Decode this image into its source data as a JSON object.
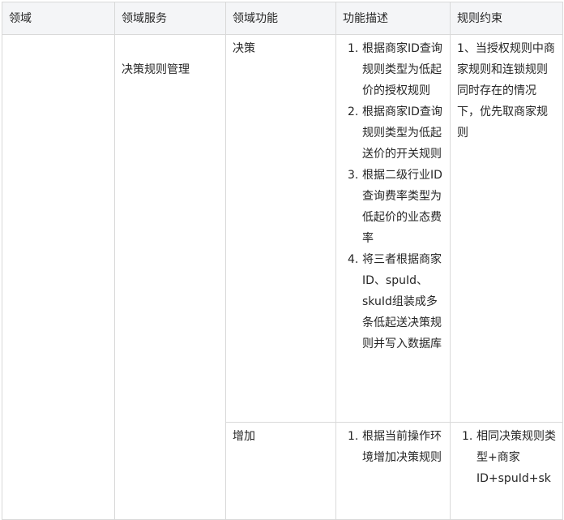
{
  "headers": [
    "领域",
    "领域服务",
    "领域功能",
    "功能描述",
    "规则约束"
  ],
  "service": "决策规则管理",
  "rows": [
    {
      "function": "决策",
      "descriptions": [
        {
          "num": "1.",
          "text": "根据商家ID查询规则类型为低起价的授权规则"
        },
        {
          "num": "2.",
          "text": "根据商家ID查询规则类型为低起送价的开关规则"
        },
        {
          "num": "3.",
          "text": "根据二级行业ID查询费率类型为低起价的业态费率"
        },
        {
          "num": "4.",
          "text": "将三者根据商家ID、spuId、skuId组装成多条低起送决策规则并写入数据库"
        }
      ],
      "constraint": "1、当授权规则中商家规则和连锁规则同时存在的情况下，优先取商家规则"
    },
    {
      "function": "增加",
      "descriptions": [
        {
          "num": "1.",
          "text": "根据当前操作环境增加决策规则"
        }
      ],
      "constraints": [
        {
          "num": "1.",
          "text": "相同决策规则类型+商家ID+spuId+sk"
        }
      ]
    }
  ]
}
